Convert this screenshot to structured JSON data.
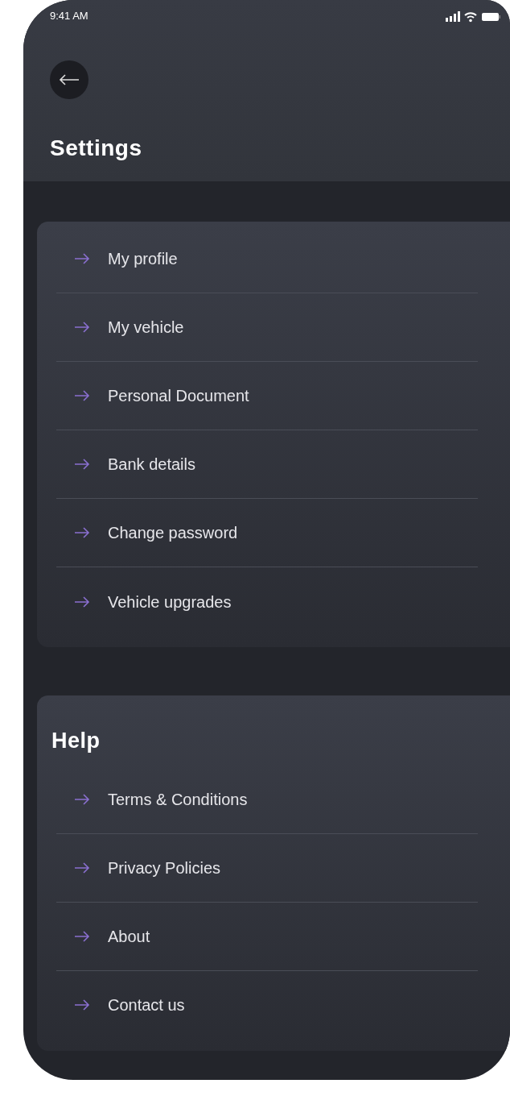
{
  "status_bar": {
    "time": "9:41 AM"
  },
  "header": {
    "title": "Settings"
  },
  "sections": [
    {
      "items": [
        {
          "label": "My profile"
        },
        {
          "label": "My vehicle"
        },
        {
          "label": "Personal Document"
        },
        {
          "label": "Bank details"
        },
        {
          "label": "Change password"
        },
        {
          "label": "Vehicle upgrades"
        }
      ]
    },
    {
      "title": "Help",
      "items": [
        {
          "label": "Terms & Conditions"
        },
        {
          "label": "Privacy Policies"
        },
        {
          "label": "About"
        },
        {
          "label": "Contact us"
        }
      ]
    }
  ]
}
